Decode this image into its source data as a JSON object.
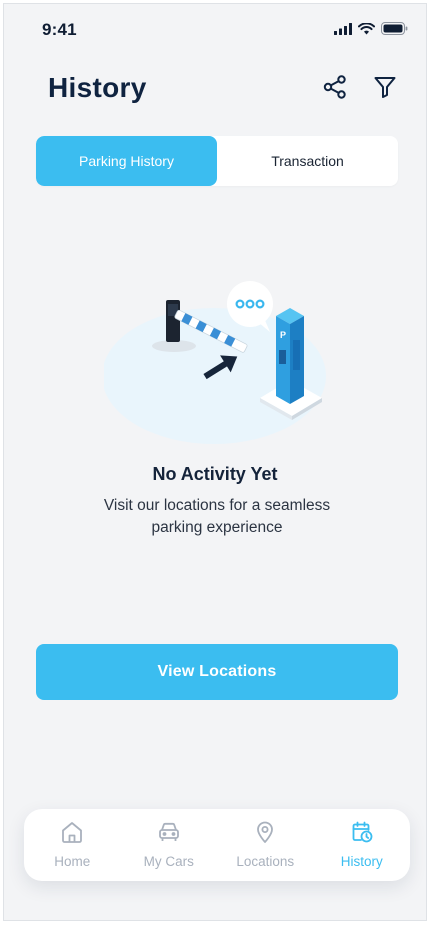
{
  "status_bar": {
    "time": "9:41"
  },
  "header": {
    "title": "History",
    "share_icon": "share-icon",
    "filter_icon": "filter-icon"
  },
  "tabs": [
    {
      "label": "Parking History",
      "active": true
    },
    {
      "label": "Transaction",
      "active": false
    }
  ],
  "empty_state": {
    "title": "No Activity Yet",
    "line1": "Visit our locations for a seamless",
    "line2": "parking experience"
  },
  "cta": {
    "label": "View Locations"
  },
  "bottom_nav": [
    {
      "label": "Home",
      "icon": "home-icon",
      "active": false
    },
    {
      "label": "My Cars",
      "icon": "car-icon",
      "active": false
    },
    {
      "label": "Locations",
      "icon": "location-pin-icon",
      "active": false
    },
    {
      "label": "History",
      "icon": "calendar-clock-icon",
      "active": true
    }
  ],
  "colors": {
    "accent": "#3bbdf0",
    "title": "#0f2340",
    "background": "#f3f4f6",
    "inactive_nav": "#a9b1bd"
  }
}
